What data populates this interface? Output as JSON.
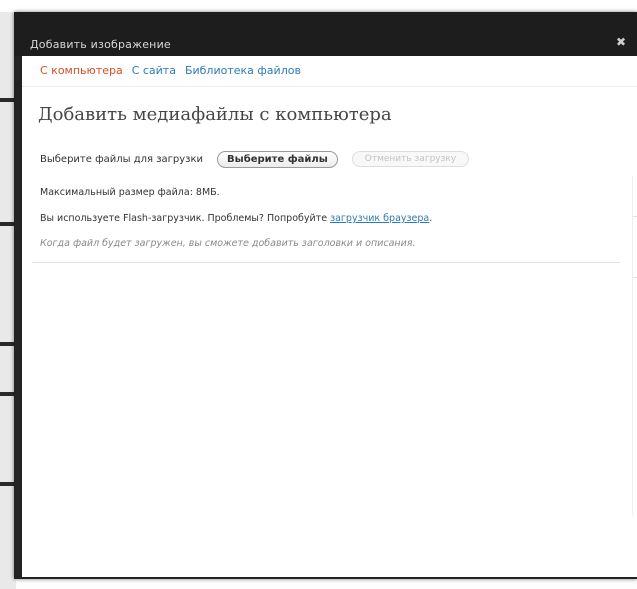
{
  "dialog": {
    "title": "Добавить изображение",
    "close_glyph": "✖"
  },
  "tabs": [
    {
      "label": "С компьютера",
      "active": true
    },
    {
      "label": "С сайта",
      "active": false
    },
    {
      "label": "Библиотека файлов",
      "active": false
    }
  ],
  "upload": {
    "heading": "Добавить медиафайлы с компьютера",
    "select_label": "Выберите файлы для загрузки",
    "select_button": "Выберите файлы",
    "cancel_button": "Отменить загрузку",
    "max_size_text": "Максимальный размер файла: 8МБ.",
    "flash_text": "Вы используете Flash-загрузчик. Проблемы? Попробуйте ",
    "browser_link": "загрузчик браузера",
    "flash_suffix": ".",
    "hint": "Когда файл будет загружен, вы сможете добавить заголовки и описания."
  },
  "colors": {
    "active_tab": "#d54e21",
    "link": "#2b7bb9",
    "titlebar": "#1d1d1d"
  }
}
